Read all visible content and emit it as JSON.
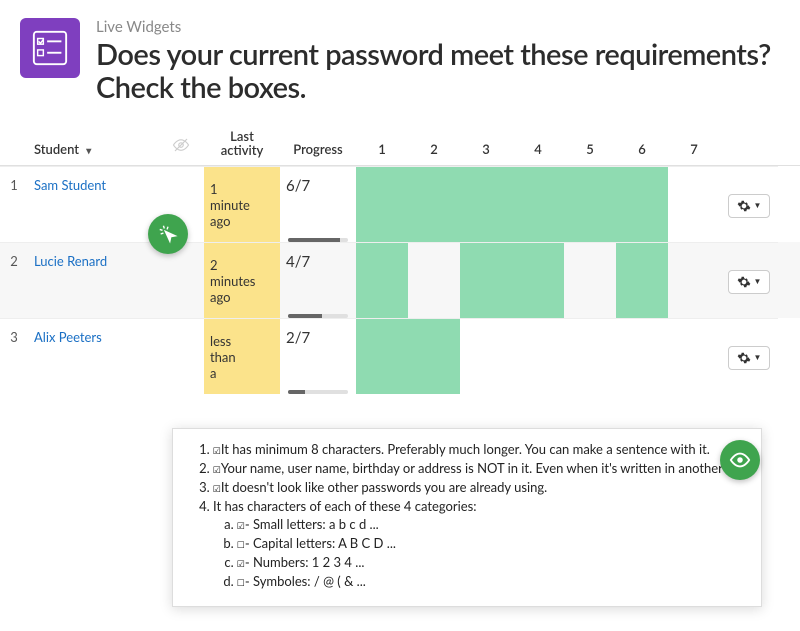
{
  "header": {
    "subtitle": "Live Widgets",
    "title": "Does your current password meet these requirements? Check the boxes."
  },
  "columns": {
    "student": "Student",
    "last_activity": "Last activity",
    "progress": "Progress",
    "q": [
      "1",
      "2",
      "3",
      "4",
      "5",
      "6",
      "7"
    ]
  },
  "rows": [
    {
      "num": "1",
      "name": "Sam Student",
      "activity": "1 minute ago",
      "progress_text": "6/7",
      "progress_pct": 86,
      "answered": [
        true,
        true,
        true,
        true,
        true,
        true,
        false
      ]
    },
    {
      "num": "2",
      "name": "Lucie Renard",
      "activity": "2 minutes ago",
      "progress_text": "4/7",
      "progress_pct": 57,
      "answered": [
        true,
        false,
        true,
        true,
        false,
        true,
        false
      ]
    },
    {
      "num": "3",
      "name": "Alix Peeters",
      "activity": "less than a",
      "progress_text": "2/7",
      "progress_pct": 29,
      "answered": [
        true,
        true,
        false,
        false,
        false,
        false,
        false
      ]
    }
  ],
  "popup": {
    "items": [
      {
        "checked": true,
        "text": "It has minimum 8 characters. Preferably much longer. You can make a sentence with it."
      },
      {
        "checked": true,
        "text": "Your name, user name, birthday or address is NOT in it. Even when it's written in another"
      },
      {
        "checked": true,
        "text": "It doesn't look like other passwords you are already using."
      },
      {
        "checked": null,
        "text": "It has characters of each of these 4 categories:",
        "sub": [
          {
            "checked": true,
            "text": "- Small letters: a b c d ..."
          },
          {
            "checked": false,
            "text": "- Capital letters: A B C D ..."
          },
          {
            "checked": true,
            "text": "- Numbers: 1 2 3 4 ..."
          },
          {
            "checked": false,
            "text": "- Symboles: / @ ( & ..."
          }
        ]
      }
    ]
  }
}
